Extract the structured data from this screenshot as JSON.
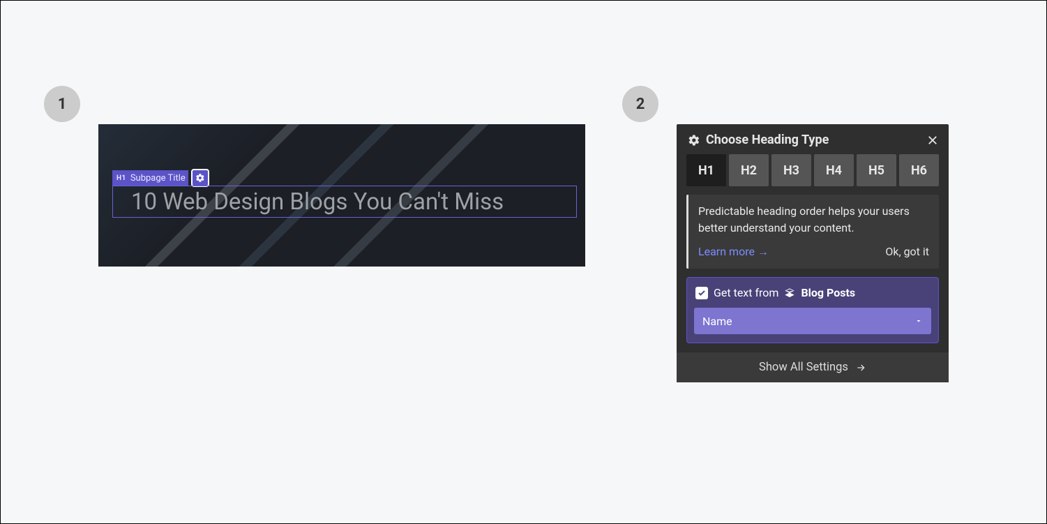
{
  "steps": {
    "one": "1",
    "two": "2"
  },
  "canvas": {
    "tag_badge": "H1",
    "tag_label": "Subpage Title",
    "heading_text": "10 Web Design Blogs You Can't Miss"
  },
  "panel": {
    "title": "Choose Heading Type",
    "tabs": [
      "H1",
      "H2",
      "H3",
      "H4",
      "H5",
      "H6"
    ],
    "active_tab": "H1",
    "info_text": "Predictable heading order helps your users better understand your content.",
    "learn_more": "Learn more →",
    "ok_got_it": "Ok, got it",
    "bind_checked": true,
    "bind_prefix": "Get text from",
    "bind_source": "Blog Posts",
    "field_selected": "Name",
    "show_all": "Show All Settings"
  }
}
